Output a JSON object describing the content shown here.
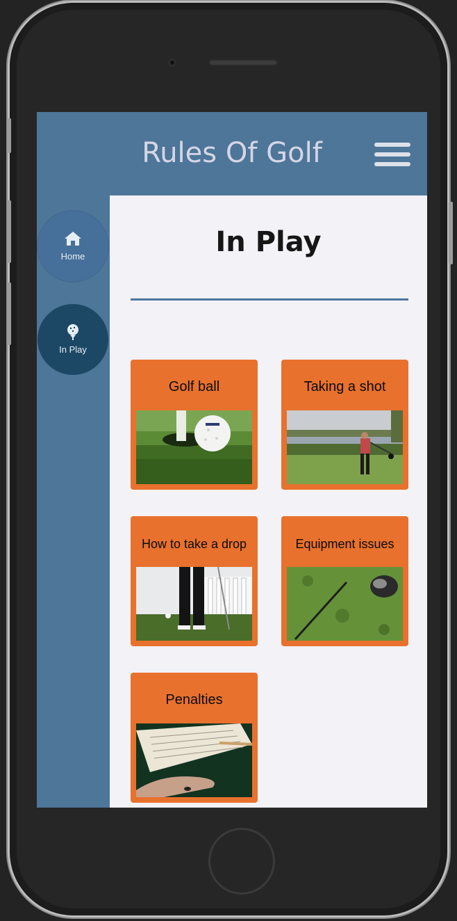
{
  "app": {
    "title": "Rules Of Golf"
  },
  "sidebar": {
    "items": [
      {
        "label": "Home",
        "icon": "home-icon"
      },
      {
        "label": "In Play",
        "icon": "golf-ball-tee-icon"
      }
    ]
  },
  "page": {
    "title": "In Play"
  },
  "cards": [
    {
      "title": "Golf ball",
      "image": "golf-ball-on-green-photo"
    },
    {
      "title": "Taking a shot",
      "image": "golfer-swing-photo"
    },
    {
      "title": "How to take a drop",
      "image": "golfer-taking-drop-photo"
    },
    {
      "title": "Equipment issues",
      "image": "broken-driver-photo"
    },
    {
      "title": "Penalties",
      "image": "scorecard-photo"
    }
  ],
  "colors": {
    "header": "#4d7699",
    "active_nav": "#1c4866",
    "card": "#e8712d",
    "content_bg": "#f3f2f7"
  }
}
